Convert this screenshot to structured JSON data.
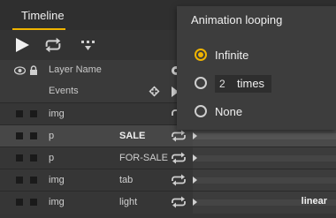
{
  "header": {
    "tab_label": "Timeline"
  },
  "columns": {
    "layer_name": "Layer Name",
    "events": "Events"
  },
  "layers": [
    {
      "type": "img",
      "name": "",
      "ease": ""
    },
    {
      "type": "p",
      "name": "SALE",
      "ease": ""
    },
    {
      "type": "p",
      "name": "FOR-SALE",
      "ease": ""
    },
    {
      "type": "img",
      "name": "tab",
      "ease": ""
    },
    {
      "type": "img",
      "name": "light",
      "ease": "linear"
    }
  ],
  "popup": {
    "title": "Animation looping",
    "options": [
      {
        "label": "Infinite",
        "selected": true
      },
      {
        "label": "times",
        "selected": false
      },
      {
        "label": "None",
        "selected": false
      }
    ],
    "times_value": "2"
  },
  "colors": {
    "accent": "#f0b400",
    "background": "#353535",
    "popup": "#3d3d3d"
  }
}
